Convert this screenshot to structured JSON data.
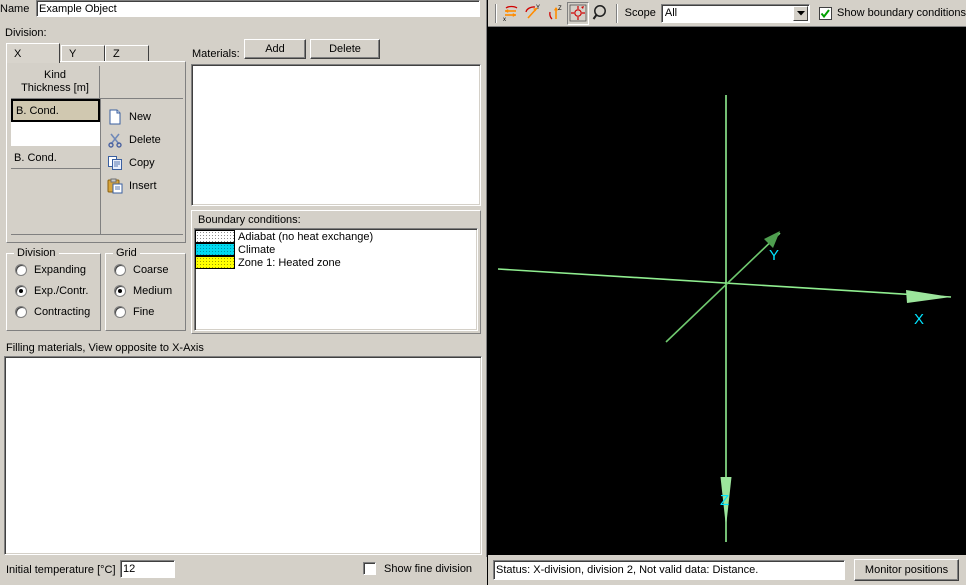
{
  "window": {
    "name_label": "Name",
    "name_value": "Example Object",
    "division_label": "Division:"
  },
  "tabs": [
    {
      "label": "X",
      "selected": true
    },
    {
      "label": "Y",
      "selected": false
    },
    {
      "label": "Z",
      "selected": false
    }
  ],
  "division_grid": {
    "header_line1": "Kind",
    "header_line2": "Thickness [m]",
    "rows": [
      {
        "kind": "B. Cond.",
        "selected": true,
        "thickness": ""
      },
      {
        "kind": "",
        "selected": false,
        "thickness": ""
      },
      {
        "kind": "B. Cond.",
        "selected": false,
        "thickness": ""
      }
    ]
  },
  "actions": [
    {
      "label": "New",
      "icon": "new-page-icon"
    },
    {
      "label": "Delete",
      "icon": "scissors-icon"
    },
    {
      "label": "Copy",
      "icon": "copy-icon"
    },
    {
      "label": "Insert",
      "icon": "paste-icon"
    }
  ],
  "division_group": {
    "legend": "Division",
    "options": [
      {
        "label": "Expanding",
        "selected": false
      },
      {
        "label": "Exp./Contr.",
        "selected": true
      },
      {
        "label": "Contracting",
        "selected": false
      }
    ]
  },
  "grid_group": {
    "legend": "Grid",
    "options": [
      {
        "label": "Coarse",
        "selected": false
      },
      {
        "label": "Medium",
        "selected": true
      },
      {
        "label": "Fine",
        "selected": false
      }
    ]
  },
  "materials": {
    "label": "Materials:",
    "add_label": "Add",
    "delete_label": "Delete",
    "items": []
  },
  "boundary_conditions": {
    "title": "Boundary conditions:",
    "items": [
      {
        "label": "Adiabat (no heat exchange)",
        "color": "#ffffff",
        "pattern": "dots-dark"
      },
      {
        "label": "Climate",
        "color": "#00d8f0",
        "pattern": "dots-dark"
      },
      {
        "label": "Zone 1: Heated zone",
        "color": "#ffff00",
        "pattern": "dots-dark"
      }
    ]
  },
  "fill_status": "Filling materials, View opposite to X-Axis",
  "bottom": {
    "temperature_label": "Initial temperature [°C]",
    "temperature_value": "12",
    "fine_division_label": "Show fine division",
    "fine_division_checked": false
  },
  "toolbar": {
    "buttons": [
      {
        "name": "rotate-x-icon",
        "title": "X"
      },
      {
        "name": "rotate-y-icon",
        "title": "Y"
      },
      {
        "name": "rotate-z-icon",
        "title": "Z"
      },
      {
        "name": "center-target-icon",
        "title": "",
        "active": true
      },
      {
        "name": "zoom-magnifier-icon",
        "title": ""
      }
    ],
    "scope_label": "Scope",
    "scope_value": "All",
    "scope_options": [
      "All"
    ],
    "show_bc_label": "Show boundary conditions",
    "show_bc_checked": true
  },
  "viewport": {
    "background": "#000000",
    "axis_color": "#90ee90",
    "label_color": "#00e5ff",
    "axes": [
      {
        "name": "X",
        "label": "X"
      },
      {
        "name": "Y",
        "label": "Y"
      },
      {
        "name": "Z",
        "label": "Z"
      }
    ]
  },
  "statusbar": {
    "text": "Status: X-division, division 2, Not valid data: Distance.",
    "monitor_label": "Monitor positions"
  }
}
